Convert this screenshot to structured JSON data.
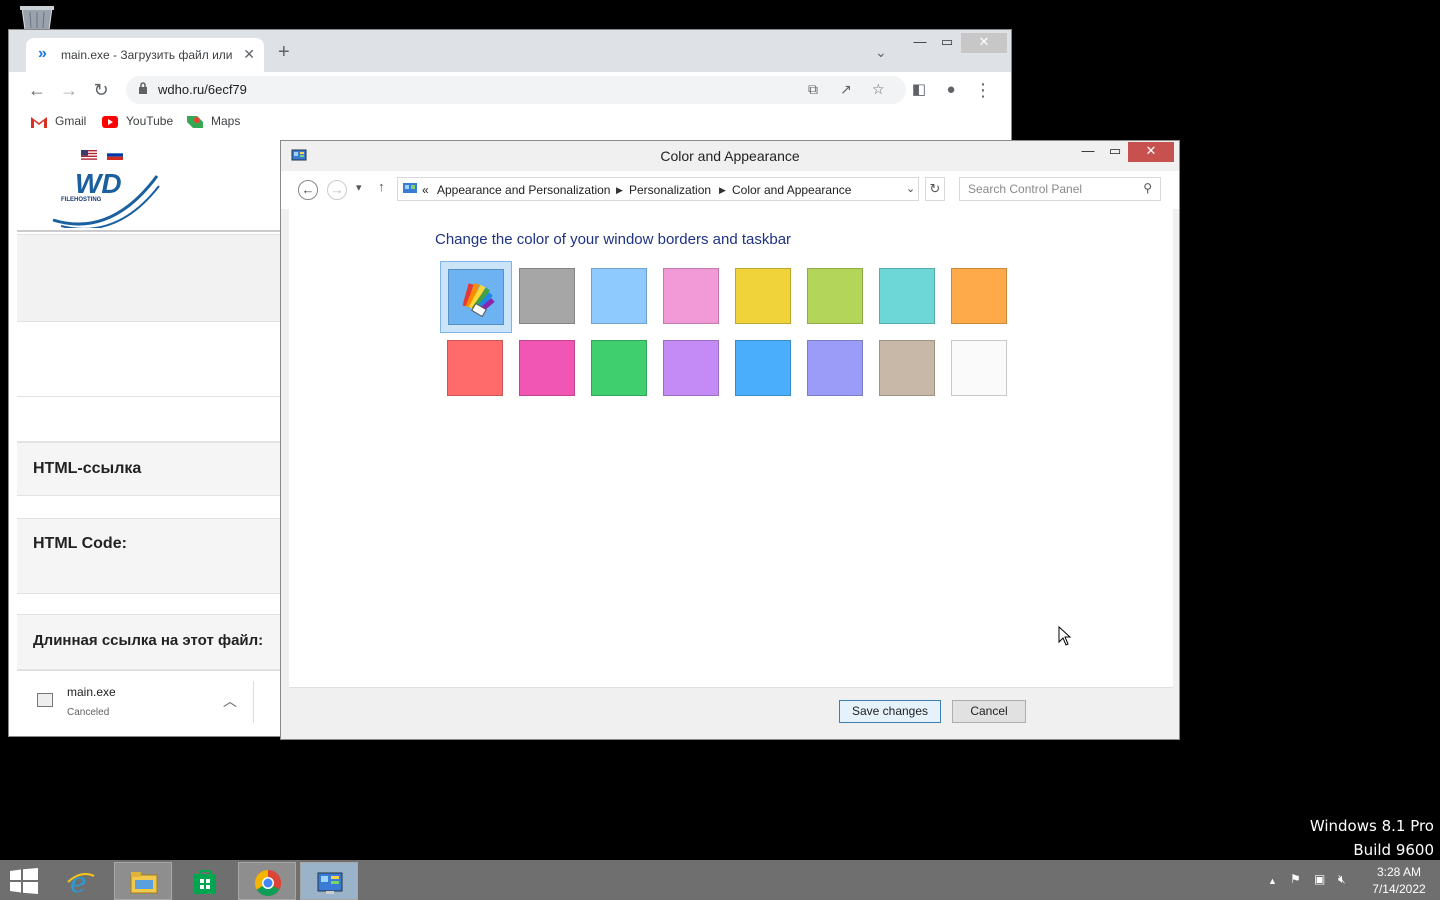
{
  "desktop": {
    "recycle_bin_icon": "recycle-bin-icon",
    "watermark_line1": "Windows 8.1 Pro",
    "watermark_line2": "Build 9600"
  },
  "browser": {
    "tab_title": "main.exe - Загрузить файл или ф...",
    "tab_title_visible": "main.exe - Загрузить файл или ф",
    "url": "wdho.ru/6ecf79",
    "bookmarks": [
      {
        "label": "Gmail",
        "icon": "gmail-icon"
      },
      {
        "label": "YouTube",
        "icon": "youtube-icon"
      },
      {
        "label": "Maps",
        "icon": "maps-icon"
      }
    ],
    "page": {
      "logo_text": "WD",
      "logo_sub": "FILEHOSTING",
      "heading_html_link": "HTML-ссылка",
      "heading_html_code": "HTML Code:",
      "heading_long_link": "Длинная ссылка на этот файл:"
    },
    "download": {
      "filename": "main.exe",
      "status": "Canceled"
    }
  },
  "control_panel": {
    "title": "Color and Appearance",
    "breadcrumb_prefix": "«",
    "breadcrumbs": [
      "Appearance and Personalization",
      "Personalization",
      "Color and Appearance"
    ],
    "search_placeholder": "Search Control Panel",
    "heading": "Change the color of your window borders and taskbar",
    "swatches_row1": [
      "auto",
      "#a6a6a6",
      "#8fcaff",
      "#f29ad8",
      "#f0d33a",
      "#b3d65a",
      "#6dd6d6",
      "#ffaa4a"
    ],
    "swatches_row2": [
      "#ff6a6a",
      "#f256b4",
      "#40cf6e",
      "#c48af5",
      "#4aaefc",
      "#9a9cf7",
      "#c8b8a8",
      "#fafafa"
    ],
    "selected_swatch": "auto",
    "save_label": "Save changes",
    "cancel_label": "Cancel"
  },
  "taskbar": {
    "time": "3:28 AM",
    "date": "7/14/2022",
    "apps": [
      "internet-explorer-icon",
      "file-explorer-icon",
      "store-icon",
      "chrome-icon",
      "control-panel-icon"
    ]
  }
}
